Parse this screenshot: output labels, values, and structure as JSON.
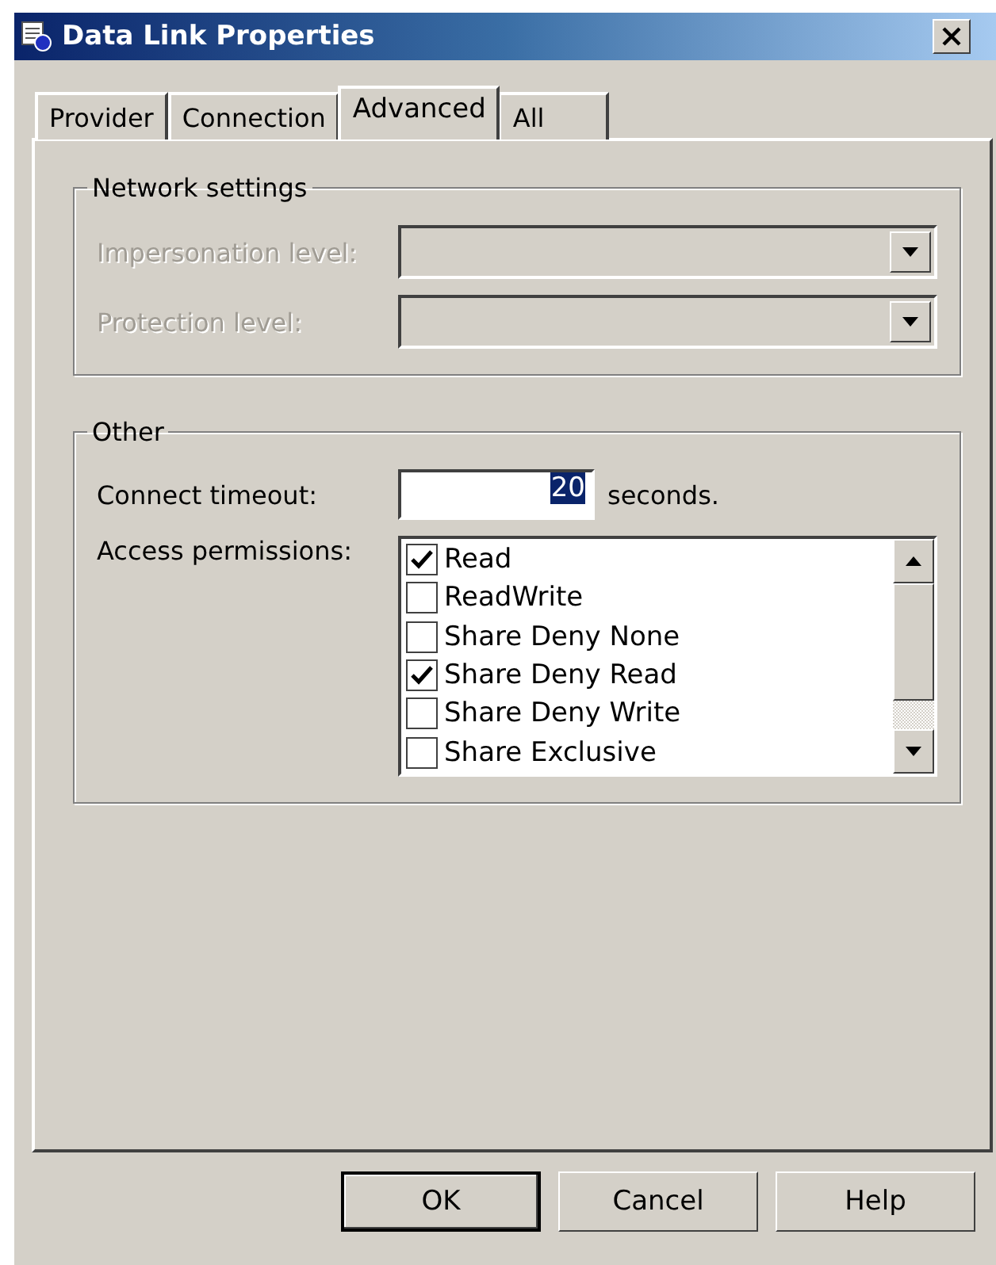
{
  "window": {
    "title": "Data Link Properties"
  },
  "tabs": [
    {
      "label": "Provider",
      "selected": false
    },
    {
      "label": "Connection",
      "selected": false
    },
    {
      "label": "Advanced",
      "selected": true
    },
    {
      "label": "All",
      "selected": false
    }
  ],
  "network_settings": {
    "title": "Network settings",
    "fields": [
      {
        "label": "Impersonation level:",
        "disabled": true
      },
      {
        "label": "Protection level:",
        "disabled": true
      }
    ]
  },
  "other": {
    "title": "Other",
    "timeout": {
      "label": "Connect timeout:",
      "value": "20",
      "unit": "seconds."
    },
    "permissions": {
      "label": "Access permissions:",
      "items": [
        {
          "label": "Read",
          "checked": true
        },
        {
          "label": "ReadWrite",
          "checked": false
        },
        {
          "label": "Share Deny None",
          "checked": false
        },
        {
          "label": "Share Deny Read",
          "checked": true
        },
        {
          "label": "Share Deny Write",
          "checked": false
        },
        {
          "label": "Share Exclusive",
          "checked": false
        }
      ]
    }
  },
  "buttons": [
    {
      "label": "OK",
      "default": true
    },
    {
      "label": "Cancel",
      "default": false
    },
    {
      "label": "Help",
      "default": false
    }
  ]
}
